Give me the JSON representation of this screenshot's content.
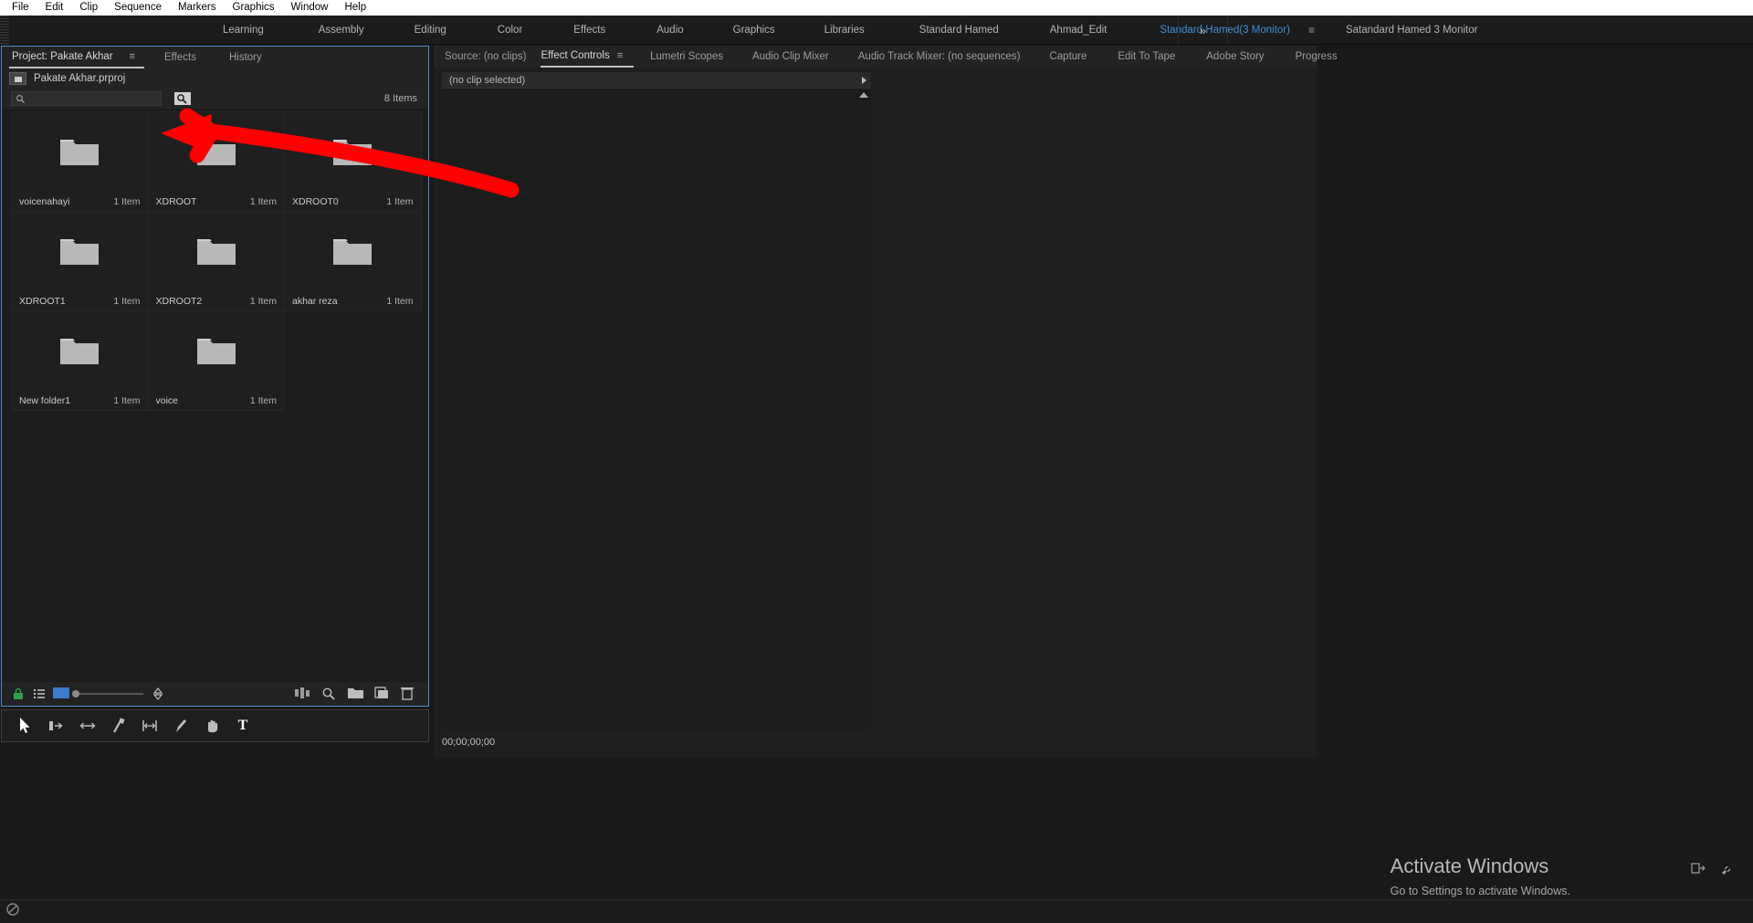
{
  "menubar": {
    "items": [
      {
        "label": "File"
      },
      {
        "label": "Edit"
      },
      {
        "label": "Clip"
      },
      {
        "label": "Sequence"
      },
      {
        "label": "Markers"
      },
      {
        "label": "Graphics"
      },
      {
        "label": "Window"
      },
      {
        "label": "Help"
      }
    ]
  },
  "workspaces": {
    "tabs": [
      {
        "label": "Learning",
        "active": false
      },
      {
        "label": "Assembly",
        "active": false
      },
      {
        "label": "Editing",
        "active": false
      },
      {
        "label": "Color",
        "active": false
      },
      {
        "label": "Effects",
        "active": false
      },
      {
        "label": "Audio",
        "active": false
      },
      {
        "label": "Graphics",
        "active": false
      },
      {
        "label": "Libraries",
        "active": false
      },
      {
        "label": "Standard Hamed",
        "active": false
      },
      {
        "label": "Ahmad_Edit",
        "active": false
      },
      {
        "label": "Standard Hamed(3 Monitor)",
        "active": true
      },
      {
        "label": "Satandard Hamed 3 Monitor",
        "active": false
      }
    ],
    "hamburger": "≡",
    "overflow_label": "»",
    "active_color": "#3f8fd8"
  },
  "project_panel": {
    "tabs": [
      {
        "label": "Project: Pakate Akhar",
        "active": true
      },
      {
        "label": "Effects",
        "active": false
      },
      {
        "label": "History",
        "active": false
      }
    ],
    "menu_glyph": "≡",
    "project_file": "Pakate Akhar.prproj",
    "search": {
      "value": "",
      "placeholder": ""
    },
    "items_count": "8 Items",
    "bins": [
      {
        "name": "voicenahayi",
        "count": "1 Item"
      },
      {
        "name": "XDROOT",
        "count": "1 Item"
      },
      {
        "name": "XDROOT0",
        "count": "1 Item"
      },
      {
        "name": "XDROOT1",
        "count": "1 Item"
      },
      {
        "name": "XDROOT2",
        "count": "1 Item"
      },
      {
        "name": "akhar reza",
        "count": "1 Item"
      },
      {
        "name": "New folder1",
        "count": "1 Item"
      },
      {
        "name": "voice",
        "count": "1 Item"
      }
    ],
    "footer_icons_left": [
      "project-lock-icon",
      "list-view-icon",
      "icon-view-icon",
      "zoom-slider-handle",
      "sort-icon"
    ],
    "footer_icons_right": [
      "freeform-view-icon",
      "find-icon",
      "new-bin-icon",
      "new-item-icon",
      "delete-icon"
    ]
  },
  "tools": {
    "items": [
      {
        "name": "selection-tool",
        "glyph": "▶"
      },
      {
        "name": "track-select-forward-tool",
        "glyph": "⇥"
      },
      {
        "name": "ripple-edit-tool",
        "glyph": "↔"
      },
      {
        "name": "razor-tool",
        "glyph": "╱"
      },
      {
        "name": "slip-tool",
        "glyph": "⌶"
      },
      {
        "name": "pen-tool",
        "glyph": "✎"
      },
      {
        "name": "hand-tool",
        "glyph": "✋"
      },
      {
        "name": "type-tool",
        "glyph": "T"
      }
    ]
  },
  "effect_controls": {
    "tabs": [
      {
        "label": "Source: (no clips)",
        "active": false
      },
      {
        "label": "Effect Controls",
        "active": true
      },
      {
        "label": "Lumetri Scopes",
        "active": false
      },
      {
        "label": "Audio Clip Mixer",
        "active": false
      },
      {
        "label": "Audio Track Mixer: (no sequences)",
        "active": false
      },
      {
        "label": "Capture",
        "active": false
      },
      {
        "label": "Edit To Tape",
        "active": false
      },
      {
        "label": "Adobe Story",
        "active": false
      },
      {
        "label": "Progress",
        "active": false
      }
    ],
    "menu_glyph": "≡",
    "clip_selection": "(no clip selected)",
    "timecode": "00;00;00;00"
  },
  "watermark": {
    "title": "Activate Windows",
    "subtitle": "Go to Settings to activate Windows."
  },
  "annotation": {
    "type": "red-arrow",
    "color": "#ff0000"
  },
  "taskbar": {
    "icon": "status-icon"
  }
}
